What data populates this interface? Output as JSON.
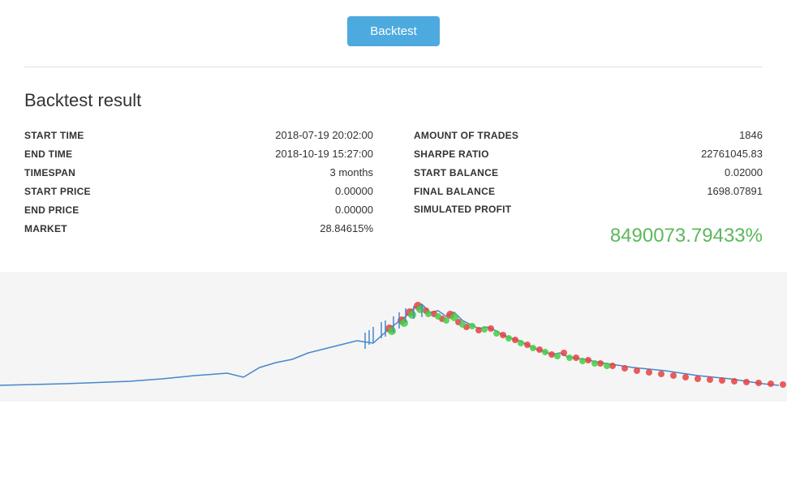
{
  "header": {
    "backtest_button_label": "Backtest"
  },
  "result": {
    "title": "Backtest result",
    "left_stats": [
      {
        "label": "START TIME",
        "value": "2018-07-19 20:02:00"
      },
      {
        "label": "END TIME",
        "value": "2018-10-19 15:27:00"
      },
      {
        "label": "TIMESPAN",
        "value": "3 months"
      },
      {
        "label": "START PRICE",
        "value": "0.00000"
      },
      {
        "label": "END PRICE",
        "value": "0.00000"
      },
      {
        "label": "MARKET",
        "value": "28.84615%"
      }
    ],
    "right_stats": [
      {
        "label": "AMOUNT OF TRADES",
        "value": "1846"
      },
      {
        "label": "SHARPE RATIO",
        "value": "22761045.83"
      },
      {
        "label": "START BALANCE",
        "value": "0.02000"
      },
      {
        "label": "FINAL BALANCE",
        "value": "1698.07891"
      }
    ],
    "simulated_profit_label": "SIMULATED PROFIT",
    "simulated_profit_value": "8490073.79433%"
  }
}
